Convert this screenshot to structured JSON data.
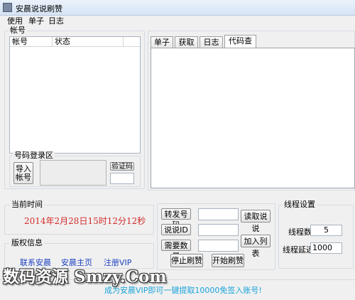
{
  "window": {
    "title": "安晨说说刷赞"
  },
  "menu": [
    "使用",
    "单子",
    "日志"
  ],
  "accounts": {
    "group_label": "帐号",
    "columns": [
      "帐号",
      "状态"
    ]
  },
  "login_area": {
    "group_label": "号码登录区",
    "import_button": "导入\n帐号",
    "captcha_button": "验证码"
  },
  "tabs": [
    {
      "label": "单子",
      "active": false
    },
    {
      "label": "获取",
      "active": false
    },
    {
      "label": "日志",
      "active": false
    },
    {
      "label": "代码查看",
      "active": true
    }
  ],
  "time": {
    "group_label": "当前时间",
    "value": "2014年2月28日15时12分12秒",
    "color": "#d42a2a"
  },
  "copyright": {
    "group_label": "版权信息",
    "links": [
      "联系安晨",
      "安晨主页",
      "注册VIP"
    ]
  },
  "controls": {
    "forward_button": "转发号码",
    "shuoshuo_id_button": "说说ID",
    "need_count_button": "需要数量",
    "read_button": "读取说说",
    "add_list_button": "加入列表",
    "stop_button": "停止刷赞",
    "start_button": "开始刷赞"
  },
  "thread": {
    "group_label": "线程设置",
    "count_label": "线程数：",
    "count_value": "5",
    "delay_label": "线程延迟",
    "delay_value": "1000"
  },
  "footer": {
    "notice": "成为安晨VIP即可一键提取10000免签入账号!",
    "notice_color": "#1aa3d9"
  },
  "watermark": "数码资源 Smzy.Com"
}
